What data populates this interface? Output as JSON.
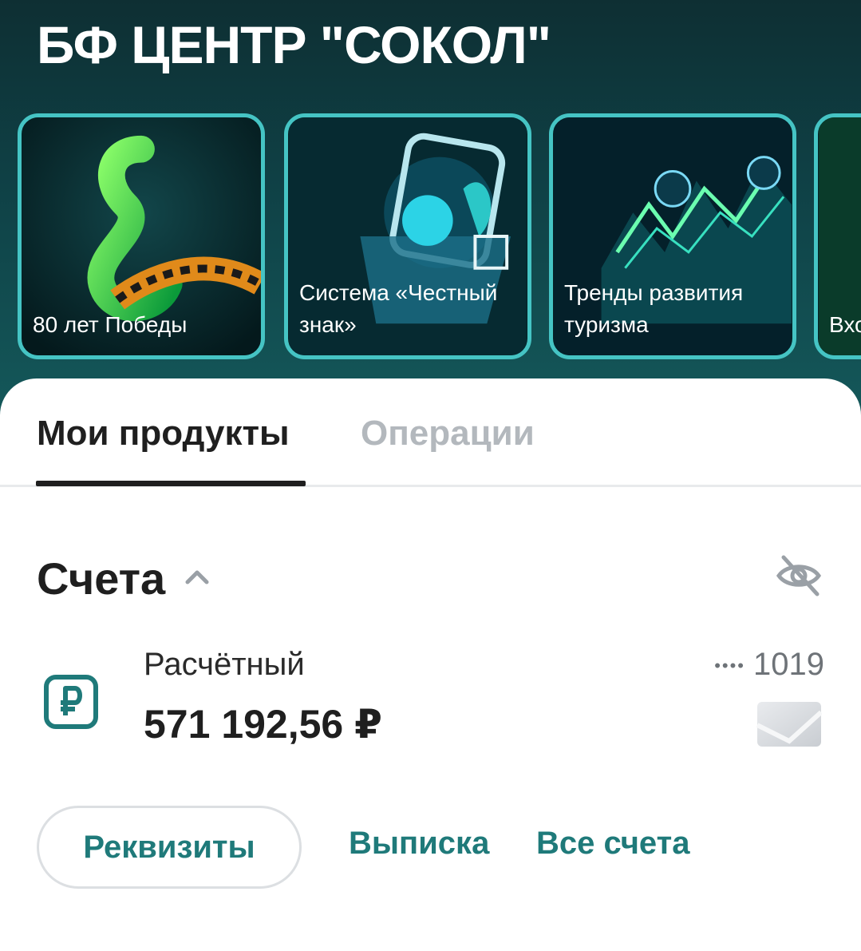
{
  "header": {
    "org_title": "БФ ЦЕНТР \"СОКОЛ\""
  },
  "stories": [
    {
      "label": "80 лет Победы"
    },
    {
      "label": "Система «Честный знак»"
    },
    {
      "label": "Тренды развития туризма"
    },
    {
      "label": "Вхо"
    }
  ],
  "tabs": [
    {
      "label": "Мои продукты",
      "active": true
    },
    {
      "label": "Операции",
      "active": false
    }
  ],
  "accounts_section": {
    "title": "Счета",
    "account": {
      "name": "Расчётный",
      "amount": "571 192,56 ₽",
      "mask_dots": "••••",
      "last_digits": "1019"
    }
  },
  "actions": {
    "requisites": "Реквизиты",
    "statement": "Выписка",
    "all_accounts": "Все счета"
  },
  "colors": {
    "accent": "#1f7a7a",
    "header_bg": "#0f4146",
    "story_border": "#45c4c4"
  }
}
